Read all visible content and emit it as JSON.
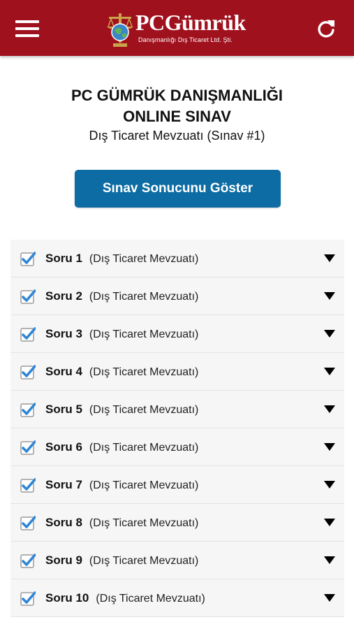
{
  "header": {
    "logo_text": "PCGümrük",
    "logo_subtitle": "Danışmanlığı Dış Ticaret Ltd. Şti.",
    "menu_icon": "hamburger-menu-icon",
    "refresh_icon": "refresh-icon",
    "bar_color": "#a0111e"
  },
  "page": {
    "title_line1": "PC GÜMRÜK DANIŞMANLIĞI",
    "title_line2": "ONLINE SINAV",
    "subtitle": "Dış Ticaret Mevzuatı (Sınav #1)"
  },
  "result_button": {
    "label": "Sınav Sonucunu Göster",
    "color": "#0c6ca3"
  },
  "questions": [
    {
      "label": "Soru 1",
      "topic": "(Dış Ticaret Mevzuatı)",
      "checked": true
    },
    {
      "label": "Soru 2",
      "topic": "(Dış Ticaret Mevzuatı)",
      "checked": true
    },
    {
      "label": "Soru 3",
      "topic": "(Dış Ticaret Mevzuatı)",
      "checked": true
    },
    {
      "label": "Soru 4",
      "topic": "(Dış Ticaret Mevzuatı)",
      "checked": true
    },
    {
      "label": "Soru 5",
      "topic": "(Dış Ticaret Mevzuatı)",
      "checked": true
    },
    {
      "label": "Soru 6",
      "topic": "(Dış Ticaret Mevzuatı)",
      "checked": true
    },
    {
      "label": "Soru 7",
      "topic": "(Dış Ticaret Mevzuatı)",
      "checked": true
    },
    {
      "label": "Soru 8",
      "topic": "(Dış Ticaret Mevzuatı)",
      "checked": true
    },
    {
      "label": "Soru 9",
      "topic": "(Dış Ticaret Mevzuatı)",
      "checked": true
    },
    {
      "label": "Soru 10",
      "topic": "(Dış Ticaret Mevzuatı)",
      "checked": true
    }
  ],
  "icons": {
    "checkbox": "checkbox-checked-icon",
    "expand": "caret-down-icon"
  }
}
